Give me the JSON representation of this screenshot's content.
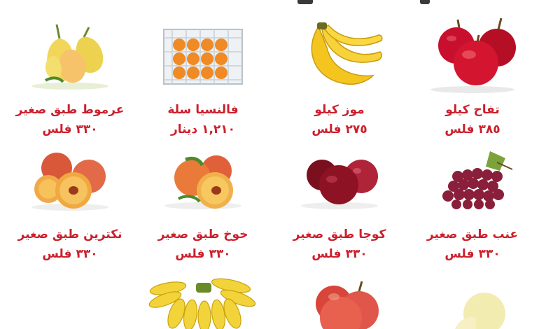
{
  "items": [
    {
      "name": "تفاح كيلو",
      "price": "٣٨٥ فلس",
      "icon": "red-apples-icon"
    },
    {
      "name": "موز كيلو",
      "price": "٢٧٥ فلس",
      "icon": "bananas-icon"
    },
    {
      "name": "فالنسيا سلة",
      "price": "١,٢١٠ دينار",
      "icon": "orange-crate-icon"
    },
    {
      "name": "عرموط طبق صغير",
      "price": "٣٣٠ فلس",
      "icon": "pears-icon"
    },
    {
      "name": "عنب طبق صغير",
      "price": "٣٣٠ فلس",
      "icon": "red-grapes-icon"
    },
    {
      "name": "كوجا طبق صغير",
      "price": "٣٣٠ فلس",
      "icon": "plums-icon"
    },
    {
      "name": "خوخ طبق صغير",
      "price": "٣٣٠ فلس",
      "icon": "peaches-icon"
    },
    {
      "name": "نكترين طبق صغير",
      "price": "٣٣٠ فلس",
      "icon": "nectarines-icon"
    },
    {
      "name": "",
      "price": "",
      "icon": "melon-icon"
    },
    {
      "name": "",
      "price": "",
      "icon": "red-apples-small-icon"
    },
    {
      "name": "",
      "price": "",
      "icon": "baby-bananas-icon"
    }
  ],
  "colors": {
    "text": "#cc1f2c"
  }
}
